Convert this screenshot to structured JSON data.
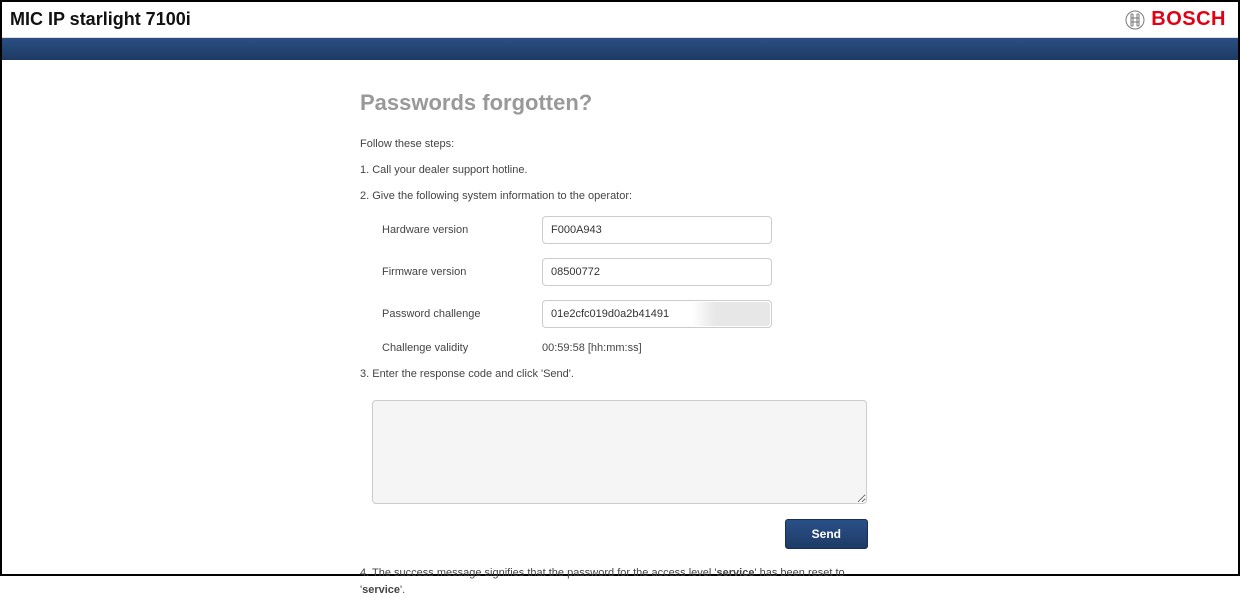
{
  "header": {
    "title": "MIC IP starlight 7100i",
    "brand": "BOSCH"
  },
  "page": {
    "heading": "Passwords forgotten?",
    "intro": "Follow these steps:",
    "step1": "1. Call your dealer support hotline.",
    "step2": "2. Give the following system information to the operator:",
    "fields": {
      "hardware_label": "Hardware version",
      "hardware_value": "F000A943",
      "firmware_label": "Firmware version",
      "firmware_value": "08500772",
      "challenge_label": "Password challenge",
      "challenge_value": "01e2cfc019d0a2b41491",
      "validity_label": "Challenge validity",
      "validity_value": "00:59:58 [hh:mm:ss]"
    },
    "step3": "3. Enter the response code and click 'Send'.",
    "response_value": "",
    "send_label": "Send",
    "step4_prefix": "4. The success message signifies that the password for the access level '",
    "step4_bold1": "service",
    "step4_mid": "' has been reset to '",
    "step4_bold2": "service",
    "step4_suffix": "'."
  }
}
